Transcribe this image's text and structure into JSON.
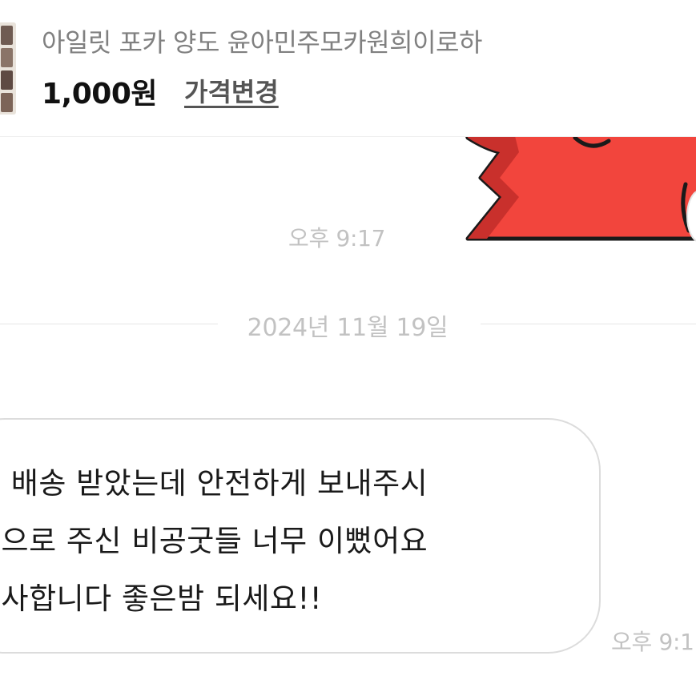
{
  "product": {
    "title": "아일릿 포카 양도 윤아민주모카원희이로하",
    "price": "1,000원",
    "price_change_label": "가격변경",
    "thumbnail_colors": [
      "#6f5b52",
      "#8a7468",
      "#5e4a43",
      "#7c6458"
    ]
  },
  "sticker_message": {
    "time": "오후 9:17",
    "colors": {
      "red": "#f2453d",
      "dark_red": "#c9302c",
      "outline": "#1a1a1a"
    }
  },
  "date_divider": {
    "text": "2024년 11월 19일"
  },
  "incoming_message": {
    "lines": [
      "늘 배송 받았는데 안전하게 보내주시",
      "덤으로 주신 비공굿들 너무 이뻤어요",
      "감사합니다 좋은밤 되세요!!"
    ],
    "time": "오후 9:1"
  }
}
